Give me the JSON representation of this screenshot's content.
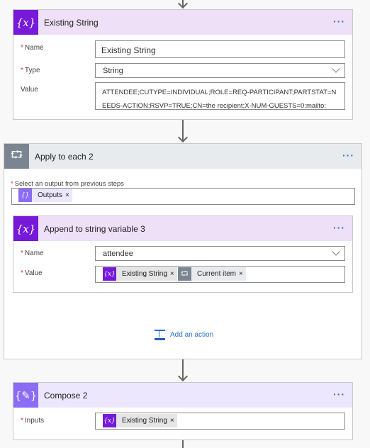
{
  "colors": {
    "variable": "#7719d8",
    "variable_header": "#ede0f7",
    "loop": "#7a8591",
    "loop_header": "#e8ebee",
    "compose": "#8c6cf5",
    "compose_header": "#ece7fd",
    "link": "#2b6fcf"
  },
  "card1": {
    "title": "Existing String",
    "icon": "variable-icon",
    "fields": {
      "name_label": "Name",
      "name_value": "Existing String",
      "type_label": "Type",
      "type_value": "String",
      "value_label": "Value",
      "value_text": "ATTENDEE;CUTYPE=INDIVIDUAL;ROLE=REQ-PARTICIPANT;PARTSTAT=NEEDS-ACTION;RSVP=TRUE;CN=the recipient;X-NUM-GUESTS=0:mailto:"
    }
  },
  "loop": {
    "title": "Apply to each 2",
    "icon": "loop-icon",
    "select_label": "Select an output from previous steps",
    "token": "Outputs",
    "inner": {
      "title": "Append to string variable 3",
      "name_label": "Name",
      "name_value": "attendee",
      "value_label": "Value",
      "tokens": [
        "Existing String",
        "Current item"
      ]
    },
    "add_action": "Add an action"
  },
  "compose": {
    "title": "Compose 2",
    "icon": "compose-icon",
    "inputs_label": "Inputs",
    "token": "Existing String"
  },
  "required_mark": "*",
  "more": "···",
  "remove": "×"
}
